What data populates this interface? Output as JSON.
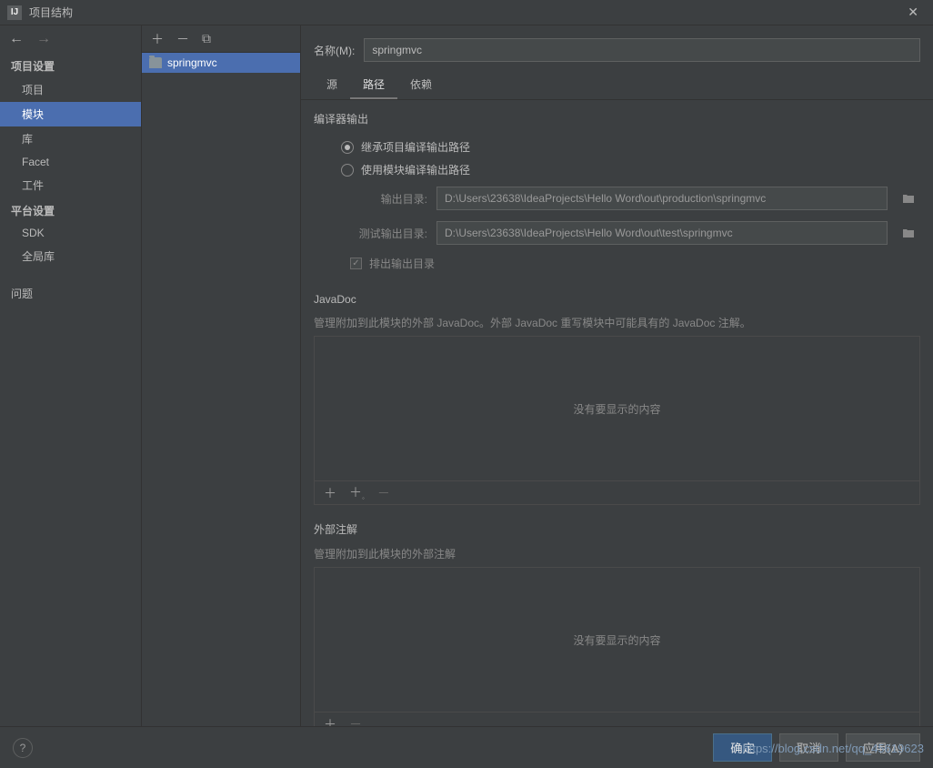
{
  "titlebar": {
    "title": "项目结构",
    "icon_text": "IJ"
  },
  "sidebar": {
    "section1": "项目设置",
    "section2": "平台设置",
    "items1": [
      "项目",
      "模块",
      "库",
      "Facet",
      "工件"
    ],
    "items2": [
      "SDK",
      "全局库"
    ],
    "problems": "问题"
  },
  "middle": {
    "items": [
      "springmvc"
    ]
  },
  "main": {
    "name_label": "名称(M):",
    "name_value": "springmvc",
    "tabs": {
      "t0": "源",
      "t1": "路径",
      "t2": "依赖"
    },
    "compiler_output": "编译器输出",
    "radio1": "继承项目编译输出路径",
    "radio2": "使用模块编译输出路径",
    "out_label": "输出目录:",
    "out_value": "D:\\Users\\23638\\IdeaProjects\\Hello Word\\out\\production\\springmvc",
    "test_out_label": "测试输出目录:",
    "test_out_value": "D:\\Users\\23638\\IdeaProjects\\Hello Word\\out\\test\\springmvc",
    "exclude_check": "排出输出目录",
    "javadoc_title": "JavaDoc",
    "javadoc_desc": "管理附加到此模块的外部 JavaDoc。外部 JavaDoc 重写模块中可能具有的 JavaDoc 注解。",
    "annotations_title": "外部注解",
    "annotations_desc": "管理附加到此模块的外部注解",
    "empty_text": "没有要显示的内容"
  },
  "footer": {
    "ok": "确定",
    "cancel": "取消",
    "apply": "应用(A)"
  },
  "watermark": "https://blog.csdn.net/qq_45619623"
}
